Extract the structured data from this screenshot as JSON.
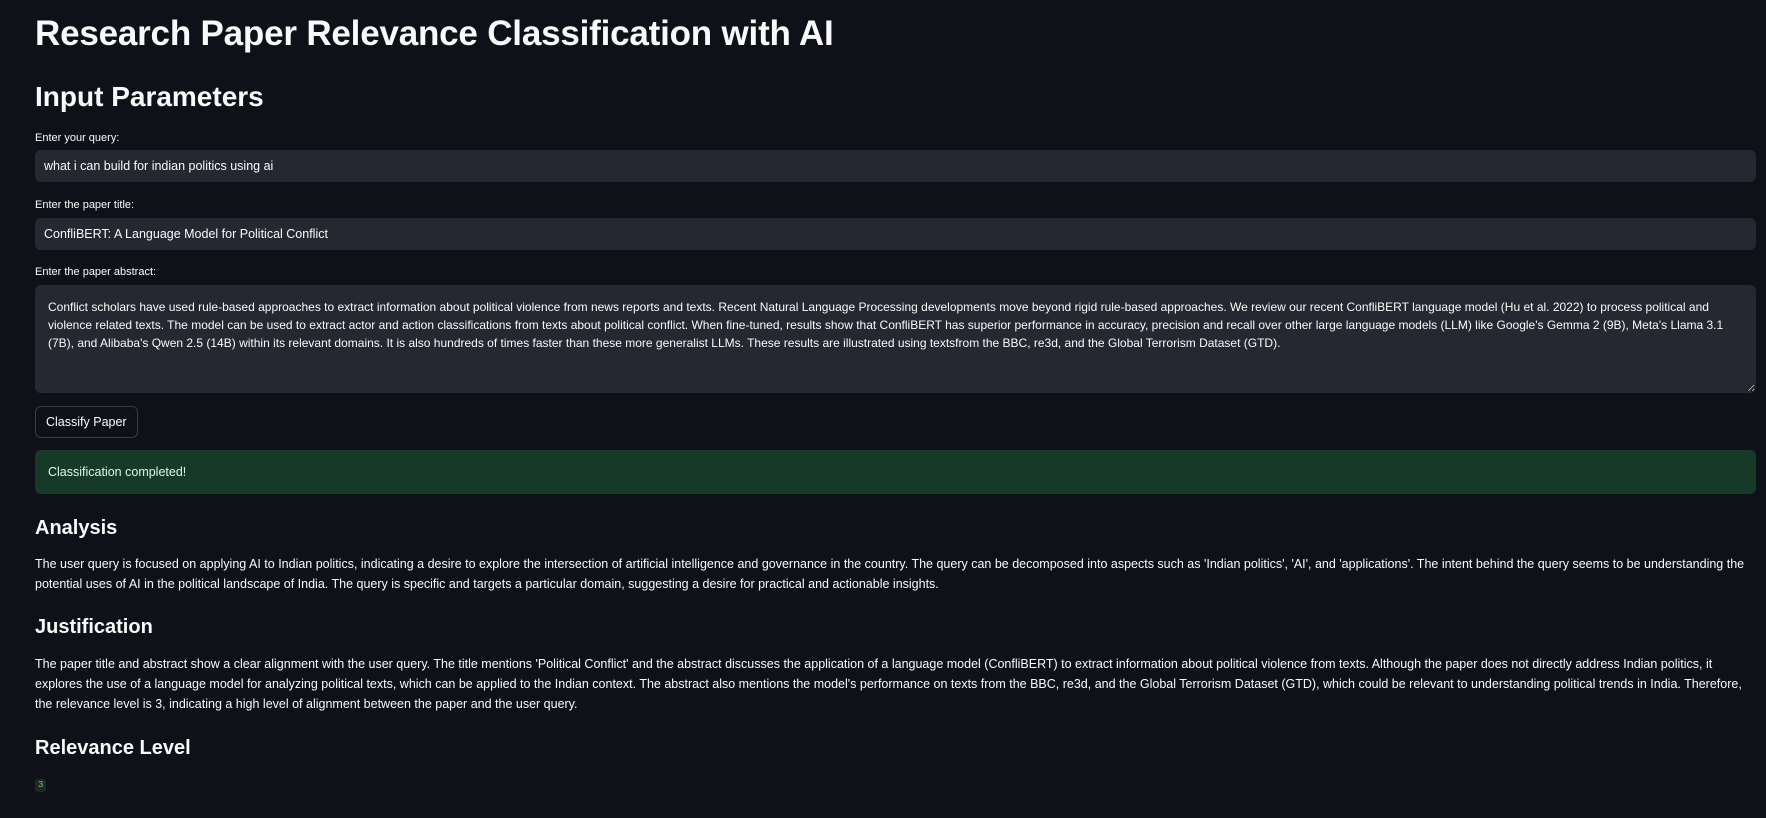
{
  "app": {
    "title": "Research Paper Relevance Classification with AI"
  },
  "inputs": {
    "heading": "Input Parameters",
    "query": {
      "label": "Enter your query:",
      "value": "what i can build for indian politics using ai"
    },
    "title": {
      "label": "Enter the paper title:",
      "value": "ConfliBERT: A Language Model for Political Conflict"
    },
    "abstract": {
      "label": "Enter the paper abstract:",
      "value": "Conflict scholars have used rule-based approaches to extract information about political violence from news reports and texts. Recent Natural Language Processing developments move beyond rigid rule-based approaches. We review our recent ConfliBERT language model (Hu et al. 2022) to process political and violence related texts. The model can be used to extract actor and action classifications from texts about political conflict. When fine-tuned, results show that ConfliBERT has superior performance in accuracy, precision and recall over other large language models (LLM) like Google's Gemma 2 (9B), Meta's Llama 3.1 (7B), and Alibaba's Qwen 2.5 (14B) within its relevant domains. It is also hundreds of times faster than these more generalist LLMs. These results are illustrated using textsfrom the BBC, re3d, and the Global Terrorism Dataset (GTD)."
    },
    "classify_button": "Classify Paper"
  },
  "status": {
    "message": "Classification completed!"
  },
  "results": {
    "analysis": {
      "heading": "Analysis",
      "text": "The user query is focused on applying AI to Indian politics, indicating a desire to explore the intersection of artificial intelligence and governance in the country. The query can be decomposed into aspects such as 'Indian politics', 'AI', and 'applications'. The intent behind the query seems to be understanding the potential uses of AI in the political landscape of India. The query is specific and targets a particular domain, suggesting a desire for practical and actionable insights."
    },
    "justification": {
      "heading": "Justification",
      "text": "The paper title and abstract show a clear alignment with the user query. The title mentions 'Political Conflict' and the abstract discusses the application of a language model (ConfliBERT) to extract information about political violence from texts. Although the paper does not directly address Indian politics, it explores the use of a language model for analyzing political texts, which can be applied to the Indian context. The abstract also mentions the model's performance on texts from the BBC, re3d, and the Global Terrorism Dataset (GTD), which could be relevant to understanding political trends in India. Therefore, the relevance level is 3, indicating a high level of alignment between the paper and the user query."
    },
    "relevance": {
      "heading": "Relevance Level",
      "value": "3"
    }
  },
  "colors": {
    "background": "#0e1117",
    "input_background": "#262730",
    "success_background": "#173928",
    "relevance_badge_text": "#5cc886"
  }
}
